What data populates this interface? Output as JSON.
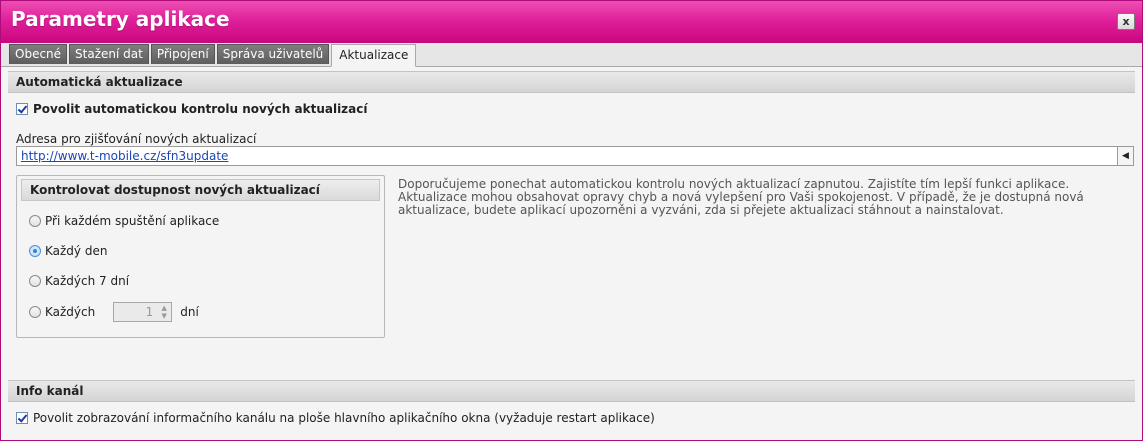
{
  "window": {
    "title": "Parametry aplikace",
    "close_label": "x"
  },
  "tabs": [
    {
      "label": "Obecné"
    },
    {
      "label": "Stažení dat"
    },
    {
      "label": "Připojení"
    },
    {
      "label": "Správa uživatelů"
    },
    {
      "label": "Aktualizace",
      "active": true
    }
  ],
  "auto_update": {
    "header": "Automatická aktualizace",
    "enable_label": "Povolit automatickou kontrolu nových aktualizací",
    "enable_checked": true,
    "url_label": "Adresa pro zjišťování nových aktualizací",
    "url_value": "http://www.t-mobile.cz/sfn3update",
    "group_title": "Kontrolovat dostupnost nových aktualizací",
    "options": [
      {
        "label": "Při každém spuštění aplikace",
        "checked": false
      },
      {
        "label": "Každý den",
        "checked": true
      },
      {
        "label": "Každých 7 dní",
        "checked": false
      },
      {
        "label": "Každých",
        "checked": false
      }
    ],
    "custom_days_value": "1",
    "custom_days_unit": "dní",
    "info": "Doporučujeme ponechat automatickou kontrolu nových aktualizací zapnutou. Zajistíte tím lepší funkci aplikace. Aktualizace mohou obsahovat opravy chyb a nová vylepšení pro Vaši spokojenost. V případě, že je dostupná nová aktualizace, budete aplikací upozorněni a vyzváni, zda si přejete aktualizaci stáhnout a nainstalovat."
  },
  "info_channel": {
    "header": "Info kanál",
    "enable_label": "Povolit zobrazování informačního kanálu na ploše hlavního aplikačního okna (vyžaduje restart aplikace)",
    "enable_checked": true
  },
  "colors": {
    "accent": "#e0209a",
    "link": "#1a46b8"
  }
}
